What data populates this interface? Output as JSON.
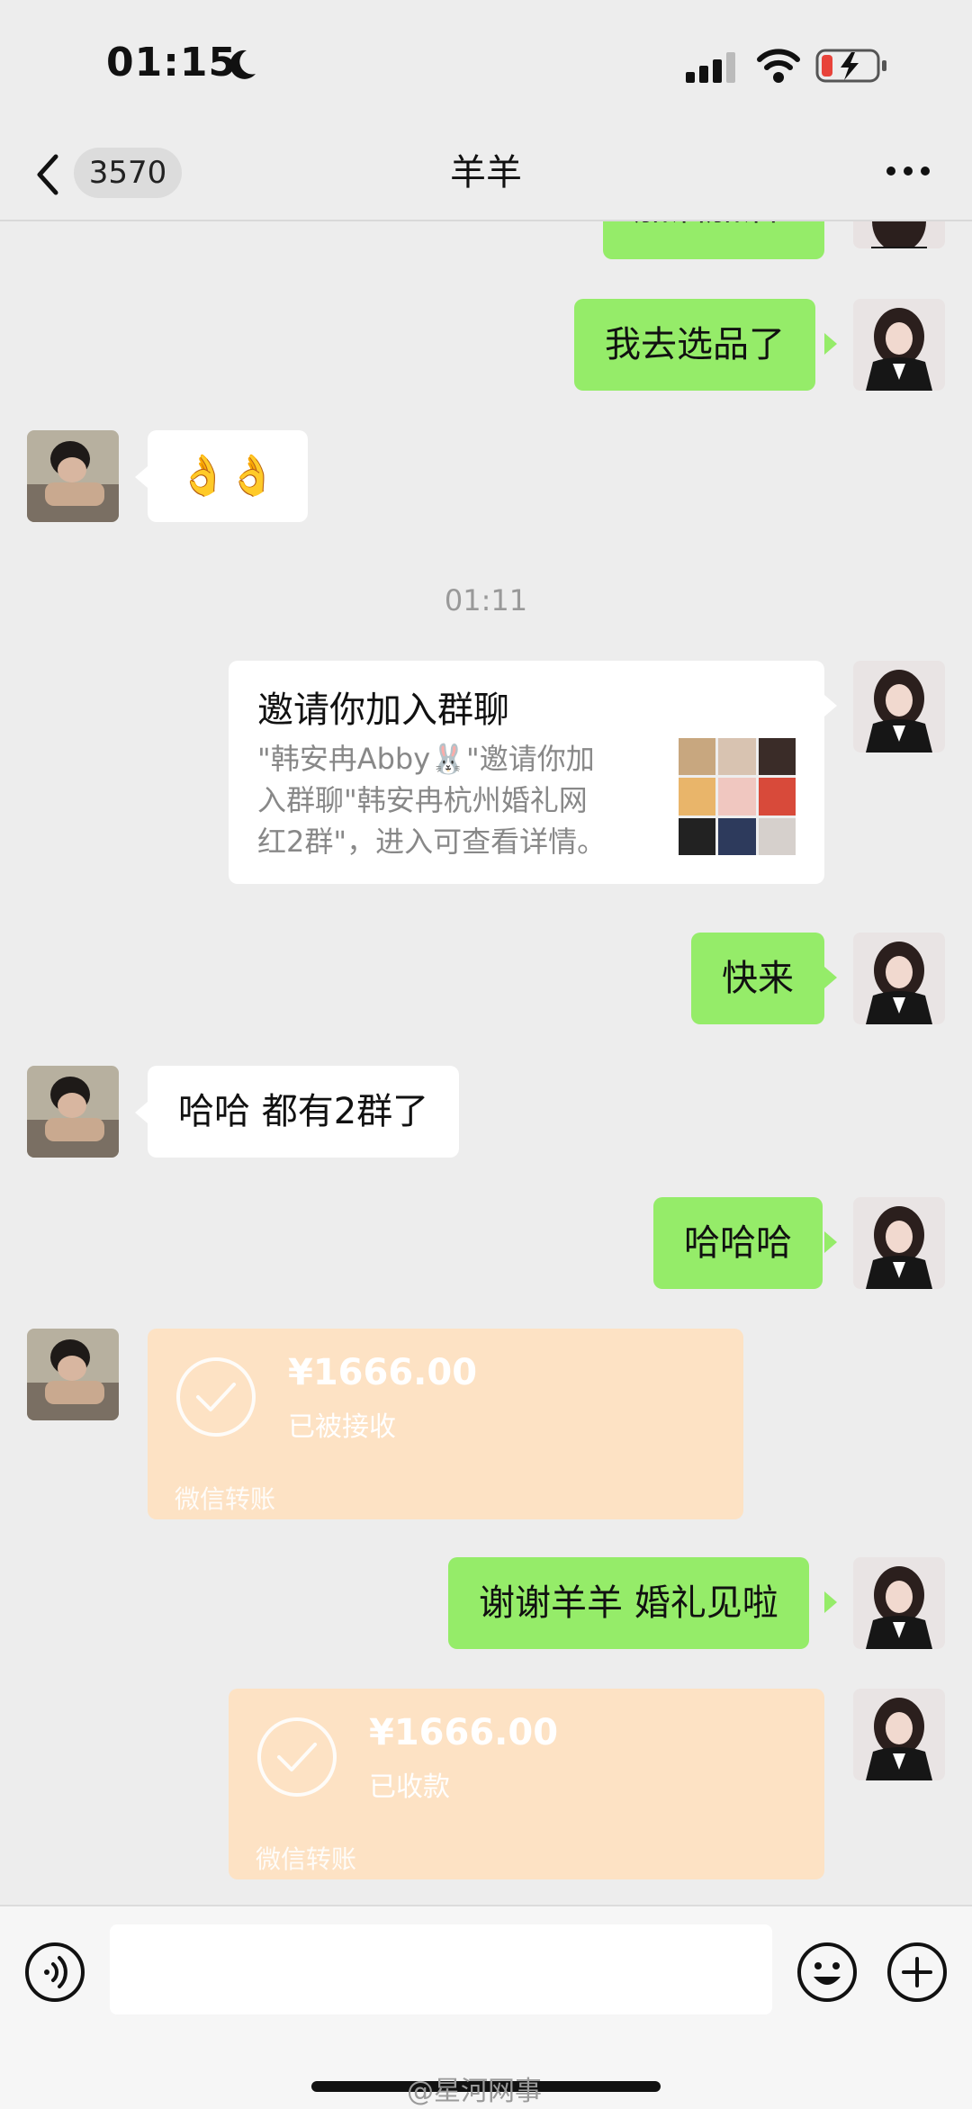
{
  "status_bar": {
    "time": "01:15"
  },
  "navbar": {
    "back_count": "3570",
    "title": "羊羊"
  },
  "messages": {
    "partial_top": "加油加油",
    "m1": "我去选品了",
    "m2_emoji": "👌👌",
    "timestamp": "01:11",
    "invite": {
      "title": "邀请你加入群聊",
      "desc": "\"韩安冉Abby🐰\"邀请你加\n入群聊\"韩安冉杭州婚礼网\n红2群\"，进入可查看详情。"
    },
    "m4": "快来",
    "m5": "哈哈 都有2群了",
    "m6": "哈哈哈",
    "transfer1": {
      "amount": "¥1666.00",
      "status": "已被接收",
      "label": "微信转账"
    },
    "m8": "谢谢羊羊 婚礼见啦",
    "transfer2": {
      "amount": "¥1666.00",
      "status": "已收款",
      "label": "微信转账"
    }
  },
  "watermark": "@星河网事"
}
